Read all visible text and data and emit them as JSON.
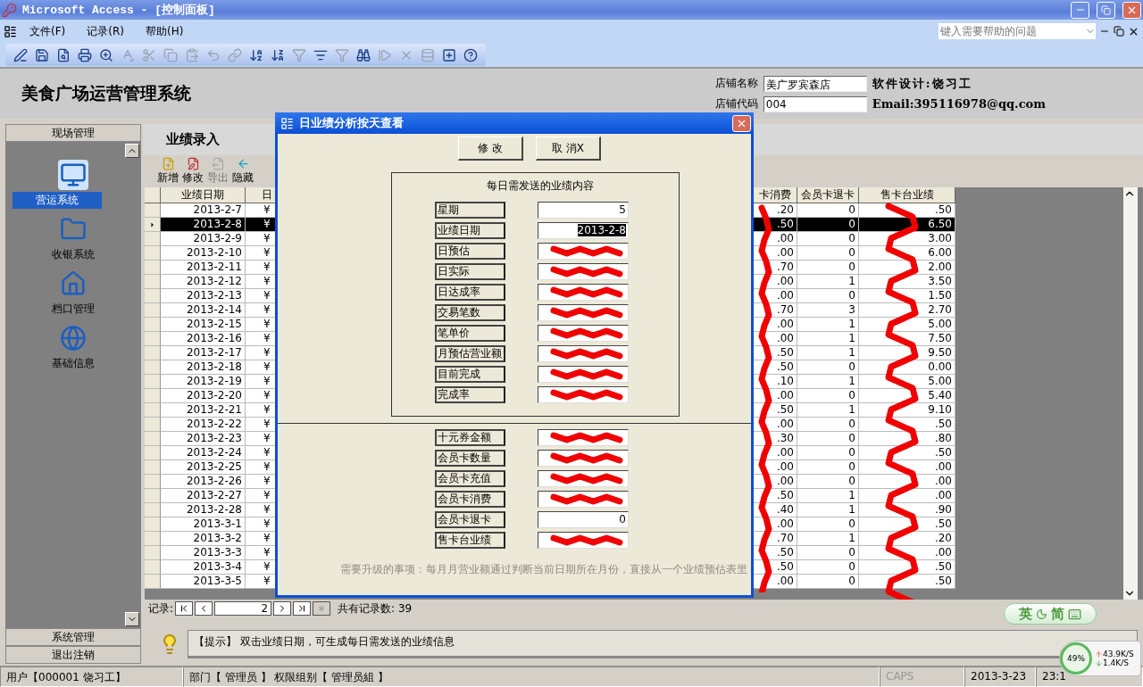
{
  "window": {
    "title": "Microsoft Access - [控制面板]"
  },
  "menu": [
    "文件(F)",
    "记录(R)",
    "帮助(H)"
  ],
  "help_box": {
    "placeholder": "键入需要帮助的问题"
  },
  "toolbar": [
    {
      "kind": "design",
      "disabled": false
    },
    {
      "kind": "save",
      "disabled": false
    },
    {
      "kind": "search-file",
      "disabled": false
    },
    {
      "kind": "print",
      "disabled": false
    },
    {
      "kind": "preview",
      "disabled": false
    },
    {
      "kind": "spell",
      "disabled": true
    },
    {
      "kind": "cut",
      "disabled": true
    },
    {
      "kind": "copy",
      "disabled": true
    },
    {
      "kind": "paste",
      "disabled": true
    },
    {
      "kind": "undo",
      "disabled": true
    },
    {
      "kind": "link",
      "disabled": true
    },
    {
      "kind": "sort-asc",
      "disabled": false
    },
    {
      "kind": "sort-desc",
      "disabled": false
    },
    {
      "kind": "filter-sel",
      "disabled": true
    },
    {
      "kind": "filter-form",
      "disabled": false
    },
    {
      "kind": "filter",
      "disabled": true
    },
    {
      "kind": "find",
      "disabled": false
    },
    {
      "kind": "new-rec",
      "disabled": true
    },
    {
      "kind": "delete-rec",
      "disabled": true
    },
    {
      "kind": "db-window",
      "disabled": true
    },
    {
      "kind": "new-object",
      "disabled": false
    },
    {
      "kind": "help",
      "disabled": false
    }
  ],
  "header": {
    "title": "美食广场运营管理系统",
    "fields": [
      {
        "label": "店铺名称",
        "value": "美广罗宾森店"
      },
      {
        "label": "店铺代码",
        "value": "004"
      }
    ],
    "credit": "软件设计:饶习工",
    "email": "Email:395116978@qq.com"
  },
  "sidebar": {
    "header": "现场管理",
    "items": [
      {
        "label": "营运系统",
        "kind": "monitor",
        "selected": true
      },
      {
        "label": "收银系统",
        "kind": "folder",
        "selected": false
      },
      {
        "label": "档口管理",
        "kind": "house",
        "selected": false
      },
      {
        "label": "基础信息",
        "kind": "globe",
        "selected": false
      }
    ],
    "footer_buttons": [
      "系统管理",
      "退出注销"
    ]
  },
  "form": {
    "title": "业绩录入",
    "actions": [
      {
        "label": "新增",
        "kind": "add",
        "disabled": false
      },
      {
        "label": "修改",
        "kind": "edit",
        "disabled": false
      },
      {
        "label": "导出",
        "kind": "export",
        "disabled": true
      },
      {
        "label": "隐藏",
        "kind": "hide",
        "disabled": false
      }
    ],
    "table": {
      "columns": [
        "业绩日期",
        "日",
        "卡消费",
        "会员卡退卡",
        "售卡台业绩"
      ],
      "rows": [
        {
          "cells": [
            "2013-2-7",
            "¥",
            ".20",
            "0",
            ".50"
          ],
          "selected": false
        },
        {
          "cells": [
            "2013-2-8",
            "¥",
            ".50",
            "0",
            "6.50"
          ],
          "selected": true
        },
        {
          "cells": [
            "2013-2-9",
            "¥",
            ".00",
            "0",
            "3.00"
          ],
          "selected": false
        },
        {
          "cells": [
            "2013-2-10",
            "¥",
            ".00",
            "0",
            "6.00"
          ],
          "selected": false
        },
        {
          "cells": [
            "2013-2-11",
            "¥",
            ".70",
            "0",
            "2.00"
          ],
          "selected": false
        },
        {
          "cells": [
            "2013-2-12",
            "¥",
            ".00",
            "1",
            "3.50"
          ],
          "selected": false
        },
        {
          "cells": [
            "2013-2-13",
            "¥",
            ".00",
            "0",
            "1.50"
          ],
          "selected": false
        },
        {
          "cells": [
            "2013-2-14",
            "¥",
            ".70",
            "3",
            "2.70"
          ],
          "selected": false
        },
        {
          "cells": [
            "2013-2-15",
            "¥",
            ".00",
            "1",
            "5.00"
          ],
          "selected": false
        },
        {
          "cells": [
            "2013-2-16",
            "¥",
            ".00",
            "1",
            "7.50"
          ],
          "selected": false
        },
        {
          "cells": [
            "2013-2-17",
            "¥",
            ".50",
            "1",
            "9.50"
          ],
          "selected": false
        },
        {
          "cells": [
            "2013-2-18",
            "¥",
            ".50",
            "0",
            "0.00"
          ],
          "selected": false
        },
        {
          "cells": [
            "2013-2-19",
            "¥",
            ".10",
            "1",
            "5.00"
          ],
          "selected": false
        },
        {
          "cells": [
            "2013-2-20",
            "¥",
            ".00",
            "0",
            "5.40"
          ],
          "selected": false
        },
        {
          "cells": [
            "2013-2-21",
            "¥",
            ".50",
            "1",
            "9.10"
          ],
          "selected": false
        },
        {
          "cells": [
            "2013-2-22",
            "¥",
            ".00",
            "0",
            ".50"
          ],
          "selected": false
        },
        {
          "cells": [
            "2013-2-23",
            "¥",
            ".30",
            "0",
            ".80"
          ],
          "selected": false
        },
        {
          "cells": [
            "2013-2-24",
            "¥",
            ".00",
            "0",
            ".50"
          ],
          "selected": false
        },
        {
          "cells": [
            "2013-2-25",
            "¥",
            ".00",
            "0",
            ".00"
          ],
          "selected": false
        },
        {
          "cells": [
            "2013-2-26",
            "¥",
            ".00",
            "0",
            ".00"
          ],
          "selected": false
        },
        {
          "cells": [
            "2013-2-27",
            "¥",
            ".50",
            "1",
            ".00"
          ],
          "selected": false
        },
        {
          "cells": [
            "2013-2-28",
            "¥",
            ".40",
            "1",
            ".90"
          ],
          "selected": false
        },
        {
          "cells": [
            "2013-3-1",
            "¥",
            ".00",
            "0",
            ".50"
          ],
          "selected": false
        },
        {
          "cells": [
            "2013-3-2",
            "¥",
            ".70",
            "1",
            ".20"
          ],
          "selected": false
        },
        {
          "cells": [
            "2013-3-3",
            "¥",
            ".50",
            "0",
            ".00"
          ],
          "selected": false
        },
        {
          "cells": [
            "2013-3-4",
            "¥",
            ".50",
            "0",
            ".50"
          ],
          "selected": false
        },
        {
          "cells": [
            "2013-3-5",
            "¥",
            ".00",
            "0",
            ".50"
          ],
          "selected": false
        }
      ]
    },
    "navigator": {
      "label": "记录:",
      "buttons": [
        {
          "kind": "first",
          "disabled": false
        },
        {
          "kind": "prev",
          "disabled": false
        },
        {
          "kind": "next",
          "disabled": false
        },
        {
          "kind": "last",
          "disabled": false
        },
        {
          "kind": "new",
          "disabled": true
        }
      ],
      "current": "2",
      "total": "共有记录数: 39"
    },
    "hint": "【提示】 双击业绩日期，可生成每日需发送的业绩信息"
  },
  "dialog": {
    "title": "日业绩分析按天查看",
    "buttons": [
      "修 改",
      "取 消X"
    ],
    "group_title": "每日需发送的业绩内容",
    "fields": [
      {
        "label": "星期",
        "value": "5",
        "redacted": false,
        "selected": false
      },
      {
        "label": "业绩日期",
        "value": "2013-2-8",
        "redacted": false,
        "selected": true
      },
      {
        "label": "日预估",
        "redacted": true
      },
      {
        "label": "日实际",
        "redacted": true
      },
      {
        "label": "日达成率",
        "redacted": true
      },
      {
        "label": "交易笔数",
        "redacted": true
      },
      {
        "label": "笔单价",
        "redacted": true
      },
      {
        "label": "月预估营业额",
        "redacted": true
      },
      {
        "label": "目前完成",
        "redacted": true
      },
      {
        "label": "完成率",
        "redacted": true
      }
    ],
    "extra_fields": [
      {
        "label": "十元券金额",
        "redacted": true
      },
      {
        "label": "会员卡数量",
        "redacted": true
      },
      {
        "label": "会员卡充值",
        "redacted": true
      },
      {
        "label": "会员卡消费",
        "redacted": true
      },
      {
        "label": "会员卡退卡",
        "value": "0",
        "redacted": false,
        "selected": false
      },
      {
        "label": "售卡台业绩",
        "redacted": true
      }
    ],
    "note": "需要升级的事项：每月月营业额通过判断当前日期所在月份，直接从一个业绩预估表里"
  },
  "status_bar": [
    {
      "text": "用户【000001 饶习工】",
      "disabled": false
    },
    {
      "text": "部门【 管理员 】 权限组别【 管理员組 】",
      "disabled": false
    },
    {
      "text": "CAPS",
      "disabled": true
    },
    {
      "text": "2013-3-23",
      "disabled": false
    },
    {
      "text": "23:1",
      "disabled": false
    }
  ],
  "ime_bar": {
    "lang": "英",
    "mode": "简"
  },
  "net_widget": {
    "percent": "49%",
    "up": "43.9K/S",
    "down": "1.4K/S"
  }
}
